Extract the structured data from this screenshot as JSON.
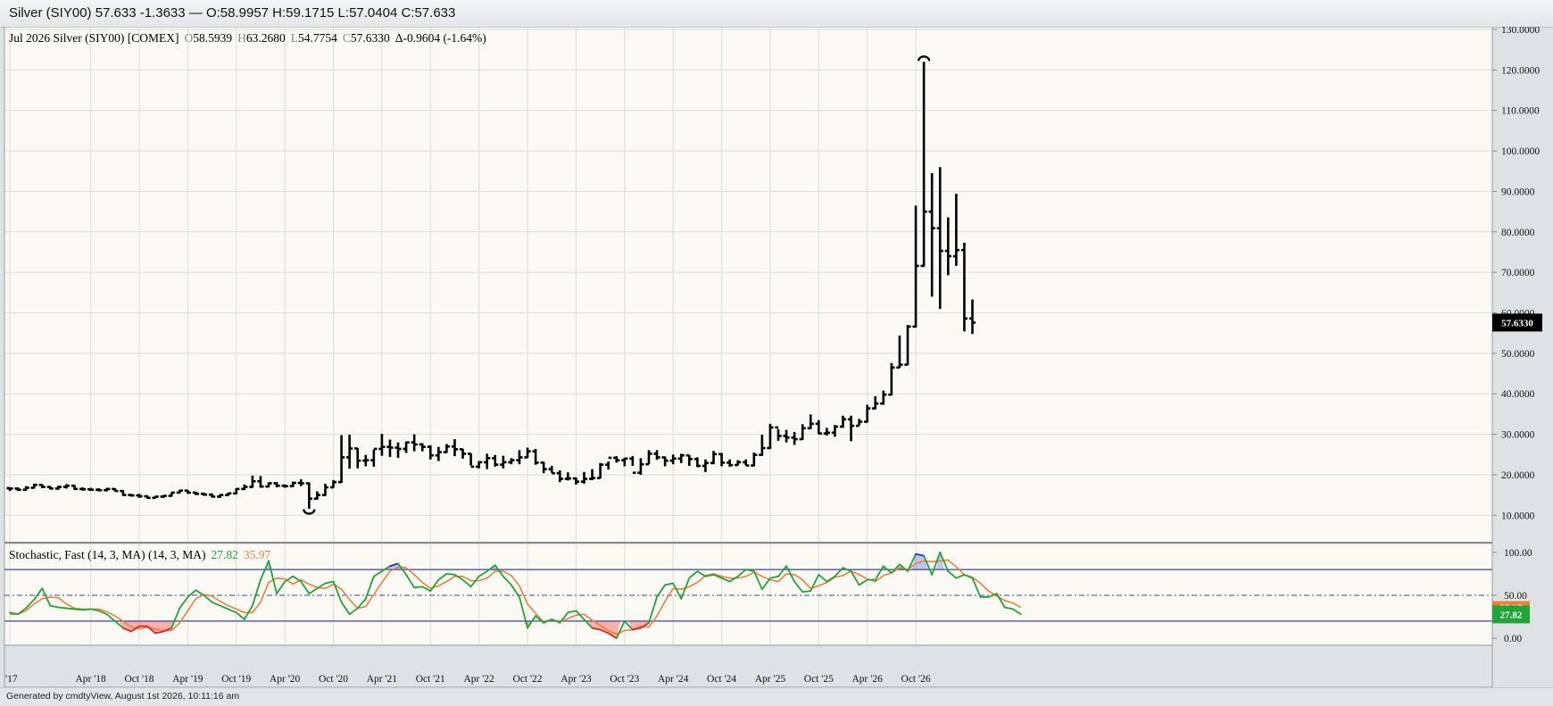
{
  "window": {
    "title": "Silver (SIY00) 57.633 -1.3633 — O:58.9957 H:59.1715 L:57.0404 C:57.633"
  },
  "footer": {
    "text": "Generated by cmdtyView, August 1st 2026, 10:11:16 am"
  },
  "colors": {
    "bars": "#000000",
    "k_line": "#1fa637",
    "d_line": "#ee7f3b",
    "overbought_fill": "#5260ea",
    "oversold_fill": "#ee2828",
    "band_line": "#3f3fa8",
    "background": "#fbf9f4",
    "grid": "#dcdcdc"
  },
  "chart_data": [
    {
      "type": "ohlc",
      "legend": {
        "title": "Jul 2026 Silver (SIY00) [COMEX]",
        "open_label": "O",
        "open": "58.5939",
        "high_label": "H",
        "high": "63.2680",
        "low_label": "L",
        "low": "54.7754",
        "close_label": "C",
        "close": "57.6330",
        "change": "Δ-0.9604 (-1.64%)"
      },
      "last_price_label": "57.6330",
      "ylim": [
        5,
        130
      ],
      "yticks": [
        "130.0000",
        "120.0000",
        "110.0000",
        "100.0000",
        "90.0000",
        "80.0000",
        "70.0000",
        "60.0000",
        "50.0000",
        "40.0000",
        "30.0000",
        "20.0000",
        "10.0000"
      ],
      "ytick_values": [
        130,
        120,
        110,
        100,
        90,
        80,
        70,
        60,
        50,
        40,
        30,
        20,
        10
      ],
      "x_start_month": "2017-06",
      "xticks": [
        "'17",
        "Apr '18",
        "Oct '18",
        "Apr '19",
        "Oct '19",
        "Apr '20",
        "Oct '20",
        "Apr '21",
        "Oct '21",
        "Apr '22",
        "Oct '22",
        "Apr '23",
        "Oct '23",
        "Apr '24",
        "Oct '24",
        "Apr '25",
        "Oct '25",
        "Apr '26",
        "Oct '26"
      ],
      "xtick_month_index": [
        0,
        10,
        16,
        22,
        28,
        34,
        40,
        46,
        52,
        58,
        64,
        70,
        76,
        82,
        88,
        94,
        100,
        106,
        112
      ],
      "ohlc": [
        [
          16.7,
          16.9,
          16.0,
          16.6
        ],
        [
          16.6,
          16.9,
          16.0,
          16.3
        ],
        [
          16.3,
          17.2,
          16.1,
          16.8
        ],
        [
          16.8,
          17.8,
          16.6,
          17.5
        ],
        [
          17.5,
          17.7,
          16.7,
          17.0
        ],
        [
          17.0,
          17.2,
          16.4,
          16.6
        ],
        [
          16.6,
          17.3,
          16.3,
          17.0
        ],
        [
          17.0,
          17.7,
          16.6,
          17.3
        ],
        [
          17.3,
          17.5,
          16.3,
          16.5
        ],
        [
          16.5,
          16.9,
          16.1,
          16.4
        ],
        [
          16.4,
          16.8,
          16.0,
          16.3
        ],
        [
          16.3,
          16.7,
          15.9,
          16.2
        ],
        [
          16.2,
          16.8,
          15.9,
          16.5
        ],
        [
          16.5,
          16.7,
          15.9,
          16.0
        ],
        [
          16.0,
          16.2,
          14.8,
          15.0
        ],
        [
          15.0,
          15.3,
          14.6,
          14.9
        ],
        [
          14.9,
          15.3,
          14.3,
          14.7
        ],
        [
          14.7,
          14.9,
          14.1,
          14.3
        ],
        [
          14.3,
          14.8,
          14.2,
          14.6
        ],
        [
          14.6,
          15.0,
          14.3,
          14.8
        ],
        [
          14.8,
          15.7,
          14.6,
          15.6
        ],
        [
          15.6,
          16.3,
          15.4,
          16.1
        ],
        [
          16.1,
          16.2,
          15.3,
          15.6
        ],
        [
          15.6,
          15.8,
          15.0,
          15.3
        ],
        [
          15.3,
          15.6,
          14.8,
          15.1
        ],
        [
          15.1,
          15.4,
          14.4,
          14.6
        ],
        [
          14.6,
          15.2,
          14.3,
          15.0
        ],
        [
          15.0,
          15.6,
          14.8,
          15.4
        ],
        [
          15.4,
          16.7,
          15.2,
          16.5
        ],
        [
          16.5,
          17.6,
          16.2,
          17.0
        ],
        [
          17.0,
          19.8,
          16.8,
          18.4
        ],
        [
          18.4,
          19.7,
          16.8,
          17.1
        ],
        [
          17.1,
          18.1,
          16.9,
          17.9
        ],
        [
          17.9,
          18.2,
          16.9,
          17.3
        ],
        [
          17.3,
          17.6,
          16.8,
          17.2
        ],
        [
          17.2,
          18.3,
          16.9,
          18.0
        ],
        [
          18.0,
          18.9,
          17.2,
          17.9
        ],
        [
          17.9,
          18.1,
          11.6,
          14.1
        ],
        [
          14.1,
          15.9,
          13.9,
          15.0
        ],
        [
          15.0,
          17.8,
          14.8,
          16.9
        ],
        [
          16.9,
          18.7,
          16.8,
          18.2
        ],
        [
          18.2,
          29.8,
          18.0,
          24.3
        ],
        [
          24.3,
          29.9,
          21.5,
          26.5
        ],
        [
          26.5,
          26.6,
          21.6,
          23.5
        ],
        [
          23.5,
          24.9,
          22.1,
          23.6
        ],
        [
          23.6,
          26.2,
          22.0,
          26.4
        ],
        [
          26.4,
          30.1,
          24.7,
          26.9
        ],
        [
          26.9,
          28.7,
          24.4,
          26.7
        ],
        [
          26.7,
          28.0,
          24.2,
          26.4
        ],
        [
          26.4,
          28.2,
          25.4,
          28.0
        ],
        [
          28.0,
          30.0,
          25.8,
          27.5
        ],
        [
          27.5,
          27.8,
          25.8,
          26.9
        ],
        [
          26.9,
          27.3,
          23.8,
          24.8
        ],
        [
          24.8,
          26.9,
          23.4,
          25.6
        ],
        [
          25.6,
          27.6,
          25.4,
          27.0
        ],
        [
          27.0,
          28.8,
          24.6,
          26.3
        ],
        [
          26.3,
          26.4,
          24.0,
          25.2
        ],
        [
          25.2,
          25.3,
          22.3,
          22.0
        ],
        [
          22.0,
          23.4,
          21.6,
          23.1
        ],
        [
          23.1,
          25.2,
          21.4,
          24.1
        ],
        [
          24.1,
          24.9,
          22.0,
          22.5
        ],
        [
          22.5,
          24.7,
          21.6,
          23.1
        ],
        [
          23.1,
          24.1,
          22.6,
          23.6
        ],
        [
          23.6,
          26.1,
          22.6,
          24.3
        ],
        [
          24.3,
          26.7,
          24.2,
          25.8
        ],
        [
          25.8,
          26.4,
          22.5,
          23.0
        ],
        [
          23.0,
          23.2,
          20.4,
          21.4
        ],
        [
          21.4,
          22.2,
          20.5,
          20.4
        ],
        [
          20.4,
          21.1,
          18.2,
          19.0
        ],
        [
          19.0,
          20.6,
          18.6,
          19.1
        ],
        [
          19.1,
          19.3,
          17.6,
          18.3
        ],
        [
          18.3,
          20.7,
          17.8,
          19.0
        ],
        [
          19.0,
          21.4,
          18.7,
          19.2
        ],
        [
          19.2,
          22.9,
          19.1,
          22.5
        ],
        [
          22.5,
          23.3,
          21.3,
          24.2
        ],
        [
          24.2,
          24.6,
          23.0,
          23.6
        ],
        [
          23.6,
          24.2,
          22.1,
          24.0
        ],
        [
          24.0,
          24.6,
          22.2,
          20.5
        ],
        [
          20.5,
          24.1,
          20.0,
          22.6
        ],
        [
          22.6,
          26.1,
          22.6,
          25.2
        ],
        [
          25.2,
          26.1,
          23.7,
          24.3
        ],
        [
          24.3,
          24.5,
          22.1,
          23.5
        ],
        [
          23.5,
          25.0,
          22.6,
          24.0
        ],
        [
          24.0,
          25.2,
          22.9,
          24.8
        ],
        [
          24.8,
          24.9,
          22.2,
          23.9
        ],
        [
          23.9,
          24.3,
          21.9,
          22.2
        ],
        [
          22.2,
          23.8,
          20.7,
          22.9
        ],
        [
          22.9,
          25.9,
          22.6,
          25.1
        ],
        [
          25.1,
          25.4,
          22.1,
          23.0
        ],
        [
          23.0,
          23.8,
          22.0,
          22.4
        ],
        [
          22.4,
          23.6,
          22.3,
          23.1
        ],
        [
          23.1,
          23.8,
          22.3,
          22.3
        ],
        [
          22.3,
          25.5,
          22.1,
          24.9
        ],
        [
          24.9,
          29.9,
          24.7,
          26.6
        ],
        [
          26.6,
          32.6,
          26.4,
          31.7
        ],
        [
          31.7,
          31.3,
          28.4,
          29.6
        ],
        [
          29.6,
          31.1,
          28.0,
          29.2
        ],
        [
          29.2,
          30.6,
          27.4,
          28.8
        ],
        [
          28.8,
          32.5,
          28.6,
          31.5
        ],
        [
          31.5,
          34.9,
          31.3,
          32.6
        ],
        [
          32.6,
          33.5,
          30.1,
          30.2
        ],
        [
          30.2,
          31.6,
          29.7,
          30.4
        ],
        [
          30.4,
          32.3,
          29.4,
          31.9
        ],
        [
          31.9,
          34.6,
          31.6,
          33.7
        ],
        [
          33.7,
          34.6,
          28.3,
          32.1
        ],
        [
          32.1,
          33.8,
          32.2,
          33.1
        ],
        [
          33.1,
          37.3,
          32.9,
          36.4
        ],
        [
          36.4,
          39.4,
          36.2,
          37.6
        ],
        [
          37.6,
          40.8,
          37.3,
          39.8
        ],
        [
          39.8,
          47.6,
          39.6,
          46.5
        ],
        [
          46.5,
          54.4,
          46.4,
          47.2
        ],
        [
          47.2,
          57.0,
          47.1,
          56.6
        ],
        [
          56.6,
          86.5,
          56.4,
          71.6
        ],
        [
          71.6,
          122.0,
          71.4,
          85.0
        ],
        [
          85.0,
          94.5,
          64.0,
          80.9
        ],
        [
          80.9,
          96.0,
          61.0,
          75.3
        ],
        [
          75.3,
          83.6,
          69.3,
          74.0
        ],
        [
          74.0,
          89.4,
          71.6,
          75.5
        ],
        [
          75.5,
          77.3,
          55.4,
          58.6
        ],
        [
          58.6,
          63.3,
          54.8,
          57.6
        ]
      ],
      "arcs": [
        {
          "index": 37,
          "value": 10.6,
          "label": "low"
        },
        {
          "index": 113,
          "value": 123.1,
          "label": "high"
        }
      ]
    },
    {
      "type": "line",
      "title": "Stochastic, Fast (14, 3, MA)  (14, 3, MA)",
      "k_value": "27.82",
      "d_value": "35.97",
      "ylim": [
        -5,
        105
      ],
      "yticks": [
        "100.00",
        "50.00",
        "0.00"
      ],
      "ytick_values": [
        100,
        50,
        0
      ],
      "overbought": 80,
      "midline": 50,
      "oversold": 20,
      "series": [
        {
          "name": "%K",
          "values": [
            30,
            28,
            35,
            45,
            58,
            38,
            36,
            35,
            34,
            33,
            34,
            32,
            28,
            20,
            12,
            8,
            14,
            14,
            6,
            8,
            12,
            35,
            48,
            56,
            50,
            42,
            38,
            34,
            30,
            22,
            38,
            68,
            90,
            52,
            66,
            72,
            66,
            52,
            58,
            64,
            66,
            42,
            28,
            35,
            46,
            72,
            78,
            84,
            87,
            74,
            59,
            60,
            55,
            68,
            75,
            74,
            68,
            60,
            72,
            78,
            85,
            72,
            62,
            48,
            12,
            26,
            18,
            22,
            18,
            30,
            32,
            22,
            12,
            10,
            6,
            0,
            20,
            10,
            12,
            18,
            48,
            62,
            64,
            46,
            70,
            78,
            72,
            74,
            70,
            66,
            72,
            80,
            78,
            57,
            70,
            72,
            84,
            66,
            54,
            55,
            74,
            66,
            72,
            82,
            78,
            62,
            68,
            68,
            84,
            76,
            86,
            78,
            98,
            96,
            74,
            100,
            78,
            70,
            74,
            70,
            48,
            48,
            52,
            36,
            34,
            28
          ],
          "colors_by_zone": {
            "above_overbought": "blue",
            "below_oversold": "red",
            "else": "green"
          }
        },
        {
          "name": "%D",
          "values": [
            28,
            28,
            32,
            40,
            46,
            48,
            47,
            40,
            35,
            34,
            34,
            34,
            31,
            26,
            20,
            13,
            11,
            13,
            11,
            9,
            9,
            18,
            32,
            46,
            51,
            49,
            43,
            38,
            34,
            30,
            30,
            42,
            65,
            70,
            69,
            63,
            68,
            63,
            59,
            58,
            63,
            57,
            45,
            35,
            37,
            51,
            65,
            78,
            83,
            82,
            74,
            65,
            58,
            61,
            66,
            72,
            72,
            67,
            67,
            70,
            78,
            78,
            73,
            61,
            40,
            29,
            19,
            22,
            19,
            23,
            27,
            28,
            21,
            15,
            9,
            5,
            9,
            10,
            14,
            13,
            26,
            43,
            58,
            57,
            60,
            65,
            73,
            75,
            72,
            70,
            70,
            72,
            77,
            72,
            68,
            66,
            75,
            74,
            68,
            58,
            61,
            65,
            71,
            73,
            78,
            74,
            69,
            66,
            73,
            76,
            82,
            80,
            87,
            90,
            89,
            90,
            91,
            83,
            74,
            71,
            64,
            55,
            49,
            44,
            41,
            36
          ]
        }
      ]
    }
  ]
}
